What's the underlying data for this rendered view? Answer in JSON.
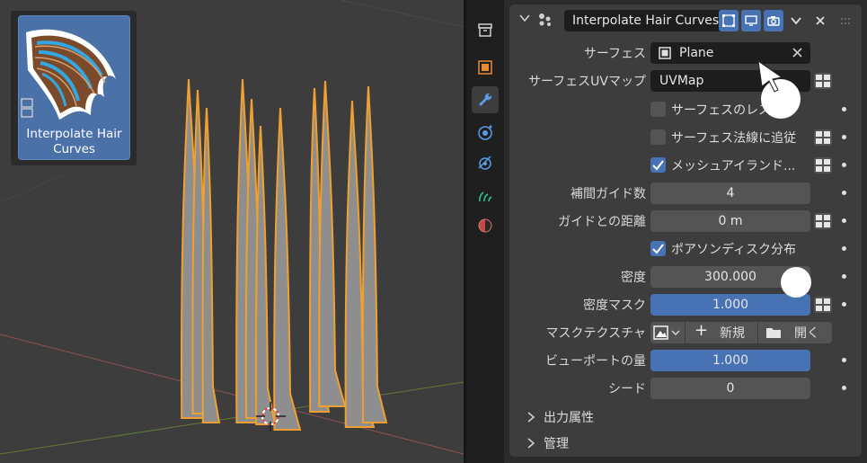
{
  "viewport": {
    "thumbnail_label": "Interpolate Hair Curves"
  },
  "tabs": [
    "object-data-icon",
    "object-icon",
    "modifier-icon",
    "particles-icon",
    "physics-icon",
    "constraints-icon",
    "material-icon"
  ],
  "modifier": {
    "name": "Interpolate Hair Curves",
    "fields": {
      "surface_label": "サーフェス",
      "surface_value": "Plane",
      "uvmap_label": "サーフェスUVマップ",
      "uvmap_value": "UVMap",
      "rest_label": "サーフェスのレスト",
      "follow_normal_label": "サーフェス法線に追従",
      "mesh_island_label": "メッシュアイランド...",
      "guides_label": "補間ガイド数",
      "guides_value": "4",
      "distance_label": "ガイドとの距離",
      "distance_value": "0 m",
      "poisson_label": "ポアソンディスク分布",
      "density_label": "密度",
      "density_value": "300.000",
      "density_mask_label": "密度マスク",
      "density_mask_value": "1.000",
      "mask_texture_label": "マスクテクスチャ",
      "new_label": "新規",
      "open_label": "開く",
      "viewport_amount_label": "ビューポートの量",
      "viewport_amount_value": "1.000",
      "seed_label": "シード",
      "seed_value": "0"
    },
    "checkboxes": {
      "rest": false,
      "follow_normal": false,
      "mesh_island": true,
      "poisson": true
    },
    "subpanels": {
      "output_attributes": "出力属性",
      "management": "管理"
    }
  },
  "colors": {
    "accent": "#4772b3",
    "selection": "#f0a030"
  }
}
